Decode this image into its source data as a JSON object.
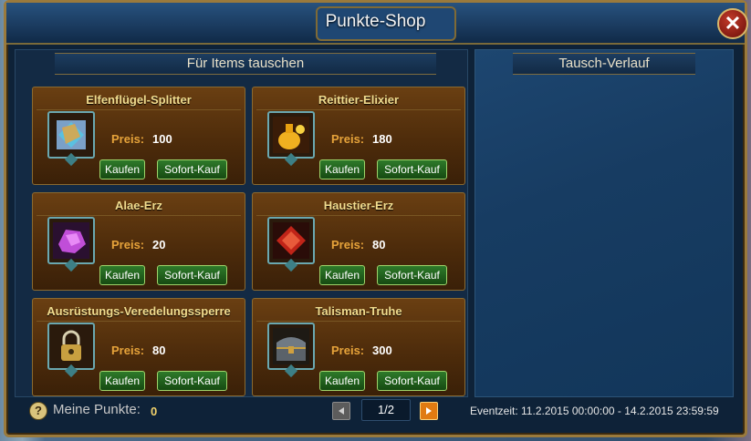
{
  "window": {
    "title": "Punkte-Shop"
  },
  "left_panel": {
    "title": "Für Items tauschen"
  },
  "right_panel": {
    "title": "Tausch-Verlauf"
  },
  "price_label": "Preis:",
  "buttons": {
    "buy": "Kaufen",
    "instant": "Sofort-Kauf"
  },
  "items": [
    {
      "name": "Elfenflügel-Splitter",
      "price": "100",
      "icon": "puzzle-icon"
    },
    {
      "name": "Reittier-Elixier",
      "price": "180",
      "icon": "potion-icon"
    },
    {
      "name": "Alae-Erz",
      "price": "20",
      "icon": "purple-ore-icon"
    },
    {
      "name": "Haustier-Erz",
      "price": "80",
      "icon": "red-ore-icon"
    },
    {
      "name": "Ausrüstungs-Veredelungssperre",
      "price": "80",
      "icon": "padlock-icon"
    },
    {
      "name": "Talisman-Truhe",
      "price": "300",
      "icon": "chest-icon"
    }
  ],
  "footer": {
    "points_label": "Meine Punkte:",
    "points_value": "0",
    "page": "1/2",
    "event_time": "Eventzeit: 11.2.2015 00:00:00 - 14.2.2015 23:59:59"
  },
  "colors": {
    "accent_gold": "#f1dc8e",
    "button_green": "#2e7a2a",
    "pager_orange": "#e07b12"
  }
}
